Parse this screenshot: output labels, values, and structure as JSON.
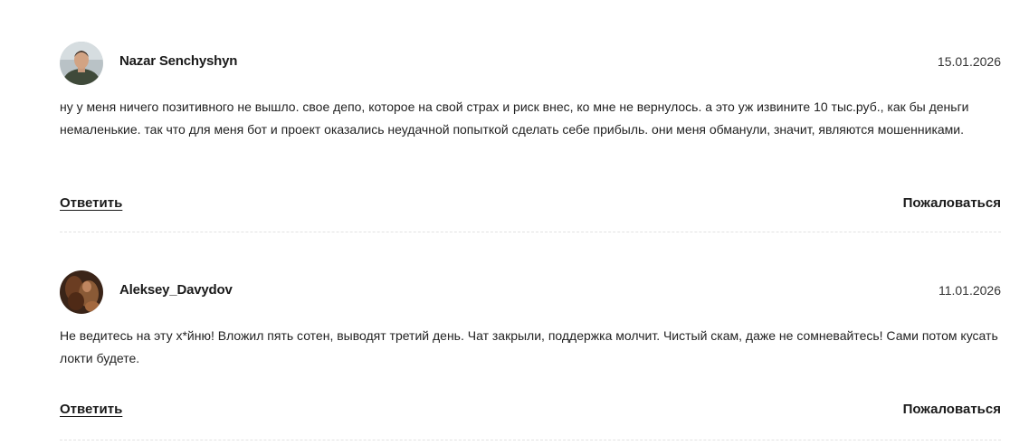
{
  "comments": [
    {
      "author": "Nazar Senchyshyn",
      "date": "15.01.2026",
      "text": "ну у меня ничего позитивного не вышло. свое депо, которое на свой страх и риск внес, ко мне не вернулось. а это уж извините 10 тыс.руб., как бы деньги немаленькие. так что для меня бот и проект оказались неудачной попыткой сделать себе прибыль. они меня обманули, значит, являются мошенниками.",
      "reply_label": "Ответить",
      "report_label": "Пожаловаться",
      "avatar_icon": "user-photo-avatar"
    },
    {
      "author": "Aleksey_Davydov",
      "date": "11.01.2026",
      "text": "Не ведитесь на эту х*йню! Вложил пять сотен, выводят третий день. Чат закрыли, поддержка молчит. Чистый скам, даже не сомневайтесь! Сами потом кусать локти будете.",
      "reply_label": "Ответить",
      "report_label": "Пожаловаться",
      "avatar_icon": "user-photo-avatar"
    }
  ]
}
